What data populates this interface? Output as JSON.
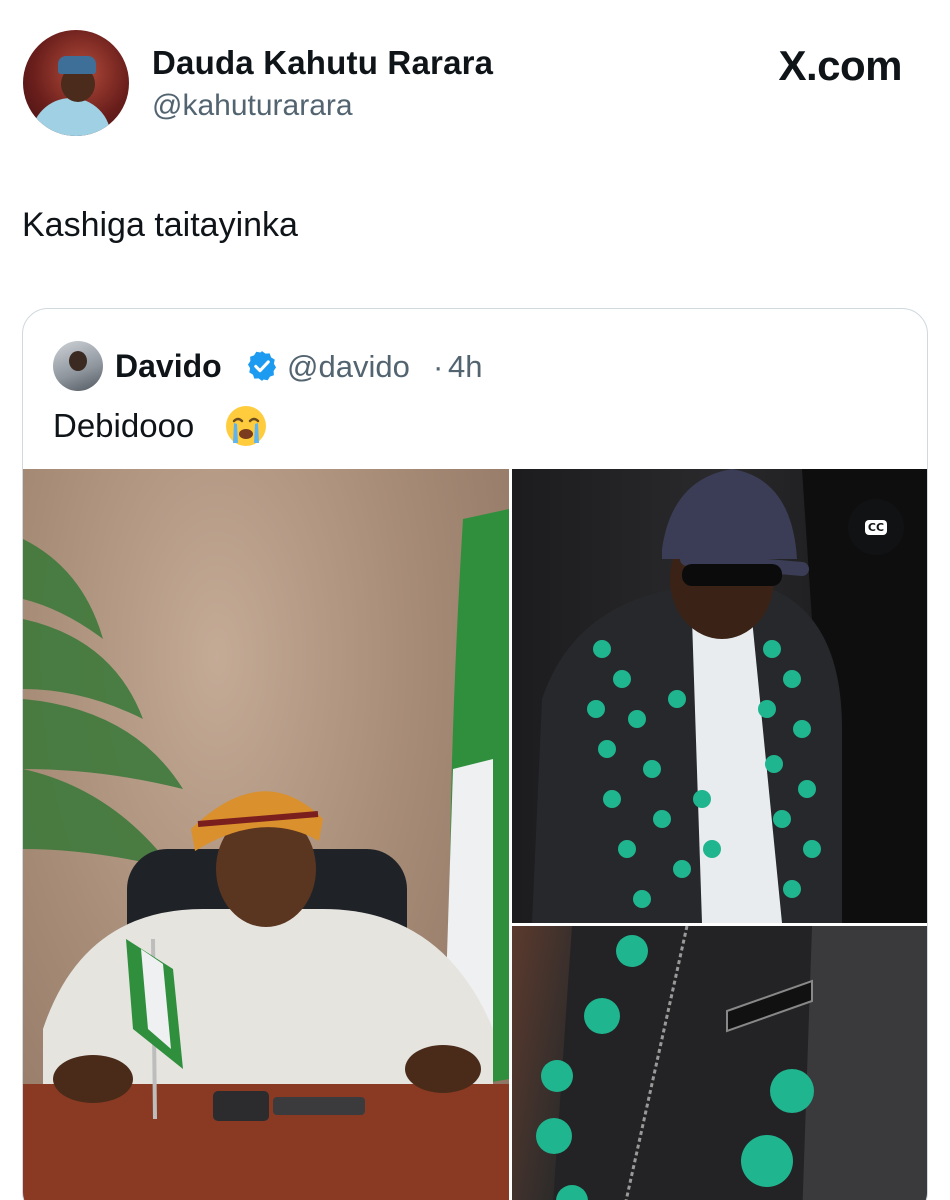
{
  "header": {
    "author_name": "Dauda Kahutu Rarara",
    "author_handle": "@kahuturarara",
    "brand": "X.com"
  },
  "tweet": {
    "text": "Kashiga taitayinka"
  },
  "quoted": {
    "author_name": "Davido",
    "author_handle": "@davido",
    "separator": "·",
    "time": "4h",
    "text": "Debidooo",
    "emoji": "loudly-crying-face",
    "verified_color": "#1d9bf0",
    "media_badge": "CC"
  },
  "colors": {
    "text": "#0f1419",
    "secondary": "#536471",
    "border": "#cfd9de",
    "accent_green": "#1fb58f",
    "flag_green": "#2f8f3d"
  }
}
